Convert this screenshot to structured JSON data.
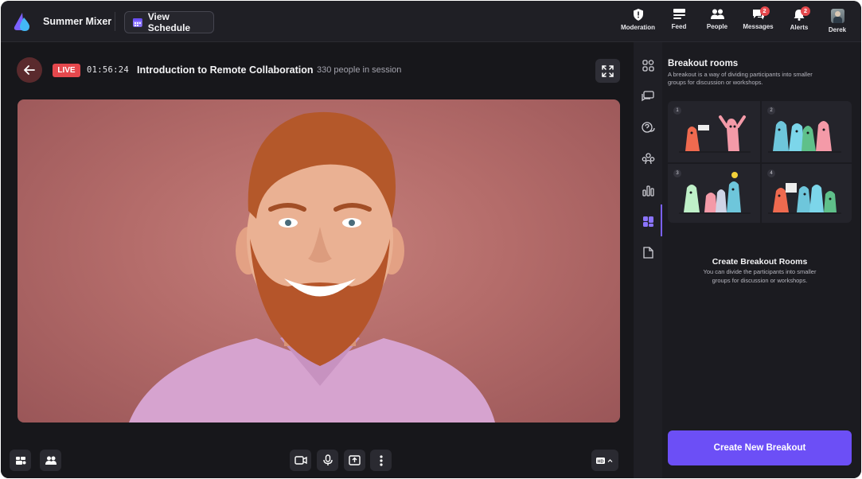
{
  "app": {
    "name": "Summer Mixer"
  },
  "topbar": {
    "view_schedule_label": "View Schedule",
    "nav": [
      {
        "label": "Moderation",
        "icon": "shield-icon",
        "badge": ""
      },
      {
        "label": "Feed",
        "icon": "feed-icon",
        "badge": ""
      },
      {
        "label": "People",
        "icon": "people-icon",
        "badge": ""
      },
      {
        "label": "Messages",
        "icon": "messages-icon",
        "badge": "2"
      },
      {
        "label": "Alerts",
        "icon": "bell-icon",
        "badge": "2"
      },
      {
        "label": "Derek",
        "icon": "avatar",
        "badge": ""
      }
    ]
  },
  "session": {
    "live_label": "LIVE",
    "timer": "01:56:24",
    "title": "Introduction to Remote Collaboration",
    "people_count": "330 people in session"
  },
  "panel": {
    "title": "Breakout rooms",
    "description": "A breakout is a way of dividing participants into smaller groups for discussion or workshops.",
    "rooms": [
      "1",
      "2",
      "3",
      "4"
    ],
    "create_title": "Create Breakout Rooms",
    "create_description": "You can divide the participants into smaller groups for discussion or workshops.",
    "create_button": "Create New Breakout"
  },
  "colors": {
    "accent": "#6c4ff6",
    "live": "#e5484d",
    "background": "#1b1b20"
  }
}
